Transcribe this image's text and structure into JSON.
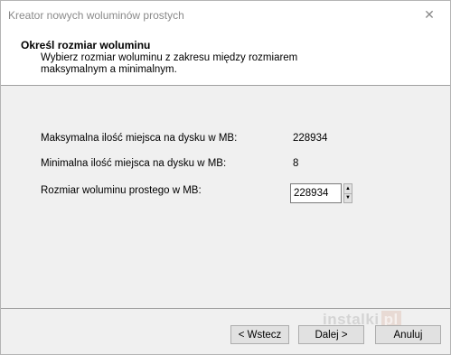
{
  "window": {
    "title": "Kreator nowych woluminów prostych",
    "close_glyph": "✕"
  },
  "header": {
    "title": "Określ rozmiar woluminu",
    "description": "Wybierz rozmiar woluminu z zakresu między rozmiarem maksymalnym a minimalnym."
  },
  "fields": {
    "max_label": "Maksymalna ilość miejsca na dysku w MB:",
    "max_value": "228934",
    "min_label": "Minimalna ilość miejsca na dysku w MB:",
    "min_value": "8",
    "size_label": "Rozmiar woluminu prostego w MB:",
    "size_value": "228934",
    "spin_up_glyph": "▲",
    "spin_down_glyph": "▼"
  },
  "buttons": {
    "back": "< Wstecz",
    "next": "Dalej >",
    "cancel": "Anuluj"
  },
  "watermark": {
    "text": "instalki",
    "badge": "pl"
  }
}
